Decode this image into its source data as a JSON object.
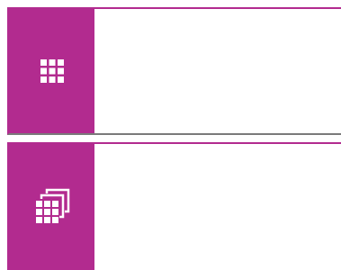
{
  "theme": {
    "accent": "#b22b8f",
    "icon_color": "#ffffff",
    "content_background": "#ffffff",
    "divider": "#7a7a7a"
  },
  "tiles": [
    {
      "icon": "table-grid-icon"
    },
    {
      "icon": "stacked-tables-icon"
    }
  ]
}
